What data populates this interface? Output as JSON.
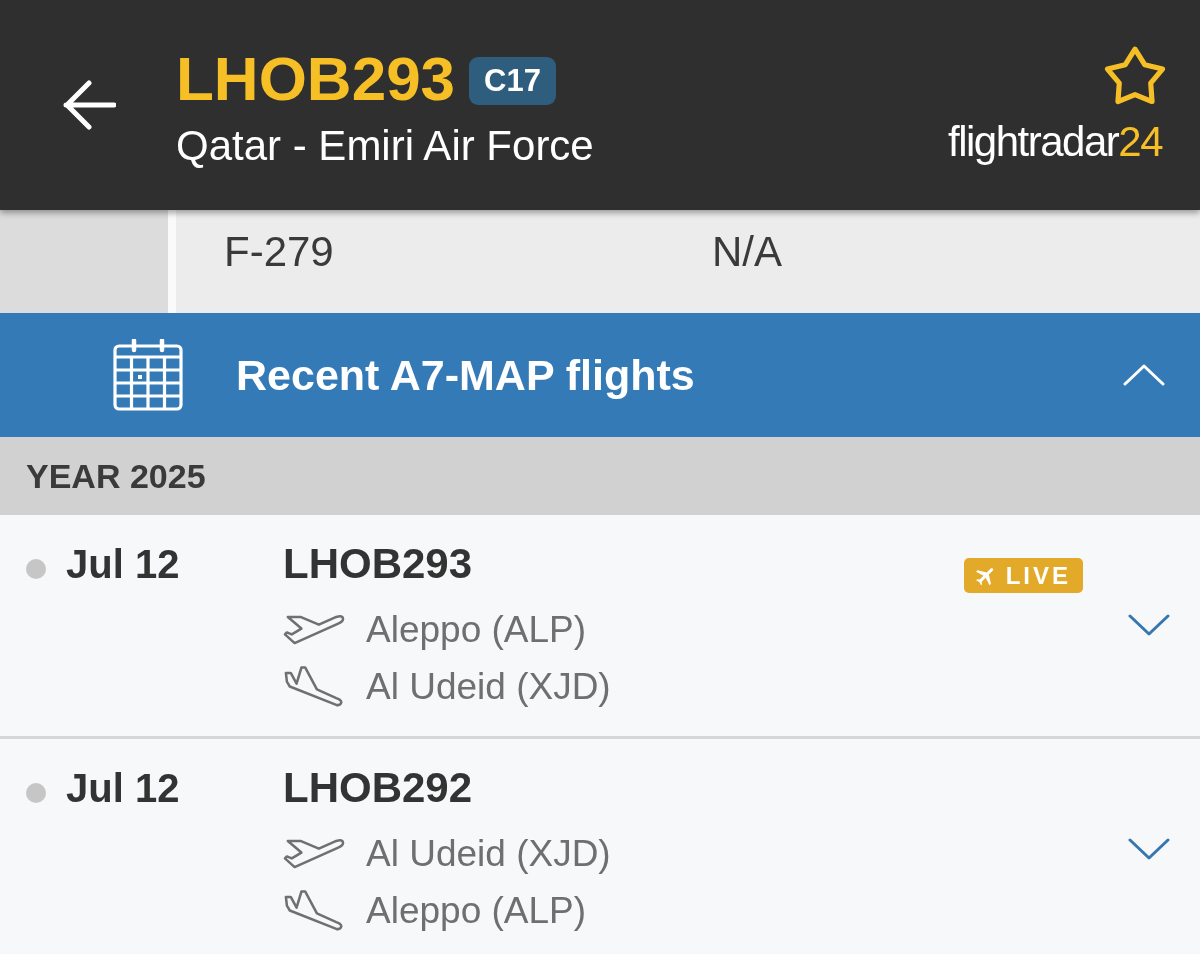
{
  "header": {
    "title": "LHOB293",
    "badge": "C17",
    "subtitle": "Qatar - Emiri Air Force",
    "starred": false,
    "logo": {
      "text": "flightradar",
      "accent": "24"
    }
  },
  "details": {
    "cells": [
      "F-279",
      "N/A"
    ]
  },
  "section": {
    "title": "Recent A7-MAP flights",
    "expanded": true
  },
  "year_group": {
    "label": "YEAR 2025"
  },
  "flights": [
    {
      "date": "Jul 12",
      "flight": "LHOB293",
      "origin": "Aleppo (ALP)",
      "destination": "Al Udeid (XJD)",
      "badge": "LIVE",
      "expanded": false
    },
    {
      "date": "Jul 12",
      "flight": "LHOB292",
      "origin": "Al Udeid (XJD)",
      "destination": "Aleppo (ALP)",
      "expanded": false
    }
  ]
}
